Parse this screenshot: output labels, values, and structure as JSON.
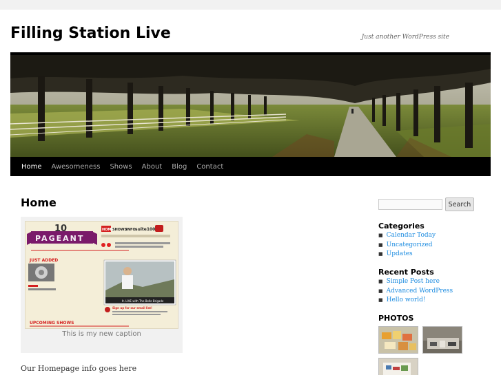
{
  "site": {
    "title": "Filling Station Live",
    "description": "Just another WordPress site"
  },
  "nav": {
    "items": [
      {
        "label": "Home",
        "current": true
      },
      {
        "label": "Awesomeness",
        "current": false
      },
      {
        "label": "Shows",
        "current": false
      },
      {
        "label": "About",
        "current": false
      },
      {
        "label": "Blog",
        "current": false
      },
      {
        "label": "Contact",
        "current": false
      }
    ]
  },
  "main": {
    "page_title": "Home",
    "figure": {
      "caption": "This is my new caption",
      "screenshot": {
        "logo_text": "PAGEANT",
        "number": "10",
        "menu_items": [
          "HOME",
          "SHOWS",
          "INFO"
        ],
        "brand": "suite100",
        "just_added": "JUST ADDED",
        "upcoming": "UPCOMING SHOWS",
        "join_text": "Join us online for the latest news & chances to win exclusive prizes",
        "video_caption": "It. LIVE with The Belle Brigade",
        "signup_text": "Sign up for our email list!"
      }
    },
    "homepage_info": "Our Homepage info goes here"
  },
  "sidebar": {
    "search": {
      "placeholder": "",
      "button_label": "Search"
    },
    "categories": {
      "title": "Categories",
      "items": [
        "Calendar Today",
        "Uncategorized",
        "Updates"
      ]
    },
    "recent_posts": {
      "title": "Recent Posts",
      "items": [
        "Simple Post here",
        "Advanced WordPress",
        "Hello world!"
      ]
    },
    "photos": {
      "title": "PHOTOS"
    }
  },
  "colors": {
    "link": "#1b8be0",
    "nav_bg": "#000000",
    "nav_text": "#aaaaaa",
    "nav_current": "#ffffff"
  }
}
